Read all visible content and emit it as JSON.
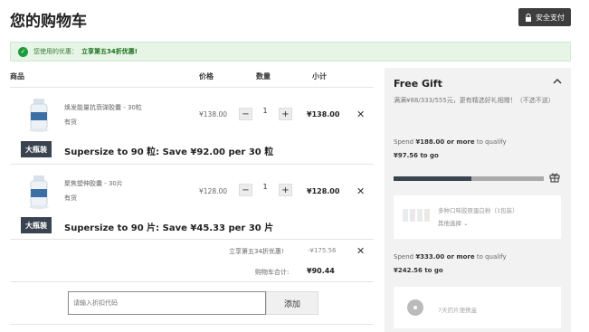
{
  "page": {
    "title": "您的购物车"
  },
  "secure_checkout": {
    "label": "安全支付"
  },
  "coupon": {
    "text": "您使用的优惠：",
    "link": "立享第五34折优惠!"
  },
  "table": {
    "headers": {
      "product": "商品",
      "price": "价格",
      "quantity": "数量",
      "subtotal": "小计"
    }
  },
  "items": [
    {
      "name": "焕发能量抗衰弹胶囊 - 30粒",
      "stock": "有货",
      "price": "¥138.00",
      "quantity": "1",
      "subtotal": "¥138.00",
      "upsell_badge": "大瓶装",
      "upsell_text": "Supersize to 90 粒: Save ¥92.00 per 30 粒"
    },
    {
      "name": "聚焦塑伸胶囊 - 30片",
      "stock": "有货",
      "price": "¥128.00",
      "quantity": "1",
      "subtotal": "¥128.00",
      "upsell_badge": "大瓶装",
      "upsell_text": "Supersize to 90 片: Save ¥45.33 per 30 片"
    }
  ],
  "discount": {
    "label": "立享第五34折优惠!",
    "value": "-¥175.56"
  },
  "total": {
    "label": "购物车合计:",
    "value": "¥90.44"
  },
  "promo": {
    "placeholder": "请输入折扣代码",
    "button": "添加"
  },
  "gift_panel": {
    "title": "Free Gift",
    "description": "满满¥88/333/555元，更有精选好礼相赠！（不选不送）",
    "tier1": {
      "prefix": "Spend ",
      "amount": "¥188.00 or more",
      "suffix": " to qualify",
      "to_go": "¥97.56 to go",
      "progress": 0.52
    },
    "gift1": {
      "name": "多种口味胶原蛋白粉（1包装）",
      "select": "其他选择 ⌄"
    },
    "tier2": {
      "prefix": "Spend ",
      "amount": "¥333.00 or more",
      "suffix": " to qualify",
      "to_go": "¥242.56 to go"
    },
    "gift2": {
      "name": "7天药片便携盒"
    }
  },
  "colors": {
    "accent": "#3a4450",
    "success": "#1f9a3b",
    "coupon_bg": "#e6f5e6"
  }
}
